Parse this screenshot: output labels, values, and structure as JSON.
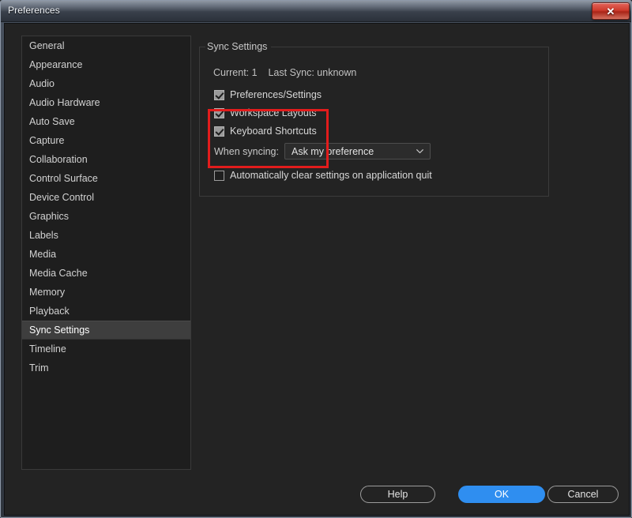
{
  "window": {
    "title": "Preferences",
    "close_icon": "close-icon",
    "close_glyph": "✕"
  },
  "sidebar": {
    "items": [
      {
        "label": "General",
        "selected": false
      },
      {
        "label": "Appearance",
        "selected": false
      },
      {
        "label": "Audio",
        "selected": false
      },
      {
        "label": "Audio Hardware",
        "selected": false
      },
      {
        "label": "Auto Save",
        "selected": false
      },
      {
        "label": "Capture",
        "selected": false
      },
      {
        "label": "Collaboration",
        "selected": false
      },
      {
        "label": "Control Surface",
        "selected": false
      },
      {
        "label": "Device Control",
        "selected": false
      },
      {
        "label": "Graphics",
        "selected": false
      },
      {
        "label": "Labels",
        "selected": false
      },
      {
        "label": "Media",
        "selected": false
      },
      {
        "label": "Media Cache",
        "selected": false
      },
      {
        "label": "Memory",
        "selected": false
      },
      {
        "label": "Playback",
        "selected": false
      },
      {
        "label": "Sync Settings",
        "selected": true
      },
      {
        "label": "Timeline",
        "selected": false
      },
      {
        "label": "Trim",
        "selected": false
      }
    ]
  },
  "main": {
    "group_title": "Sync Settings",
    "status_line": "Current: 1    Last Sync: unknown",
    "checkboxes": [
      {
        "label": "Preferences/Settings",
        "checked": true
      },
      {
        "label": "Workspace Layouts",
        "checked": true
      },
      {
        "label": "Keyboard Shortcuts",
        "checked": true
      }
    ],
    "when_syncing_label": "When syncing:",
    "when_syncing_value": "Ask my preference",
    "when_syncing_options": [
      "Ask my preference"
    ],
    "chevron_icon": "chevron-down-icon",
    "auto_clear": {
      "label": "Automatically clear settings on application quit",
      "checked": false
    }
  },
  "footer": {
    "help_label": "Help",
    "ok_label": "OK",
    "cancel_label": "Cancel"
  },
  "colors": {
    "accent_blue": "#2f8ef0",
    "annotation_red": "#e21c1c",
    "dialog_bg": "#232323",
    "list_bg": "#1e1e1e",
    "selected_row": "#3e3e3e"
  }
}
